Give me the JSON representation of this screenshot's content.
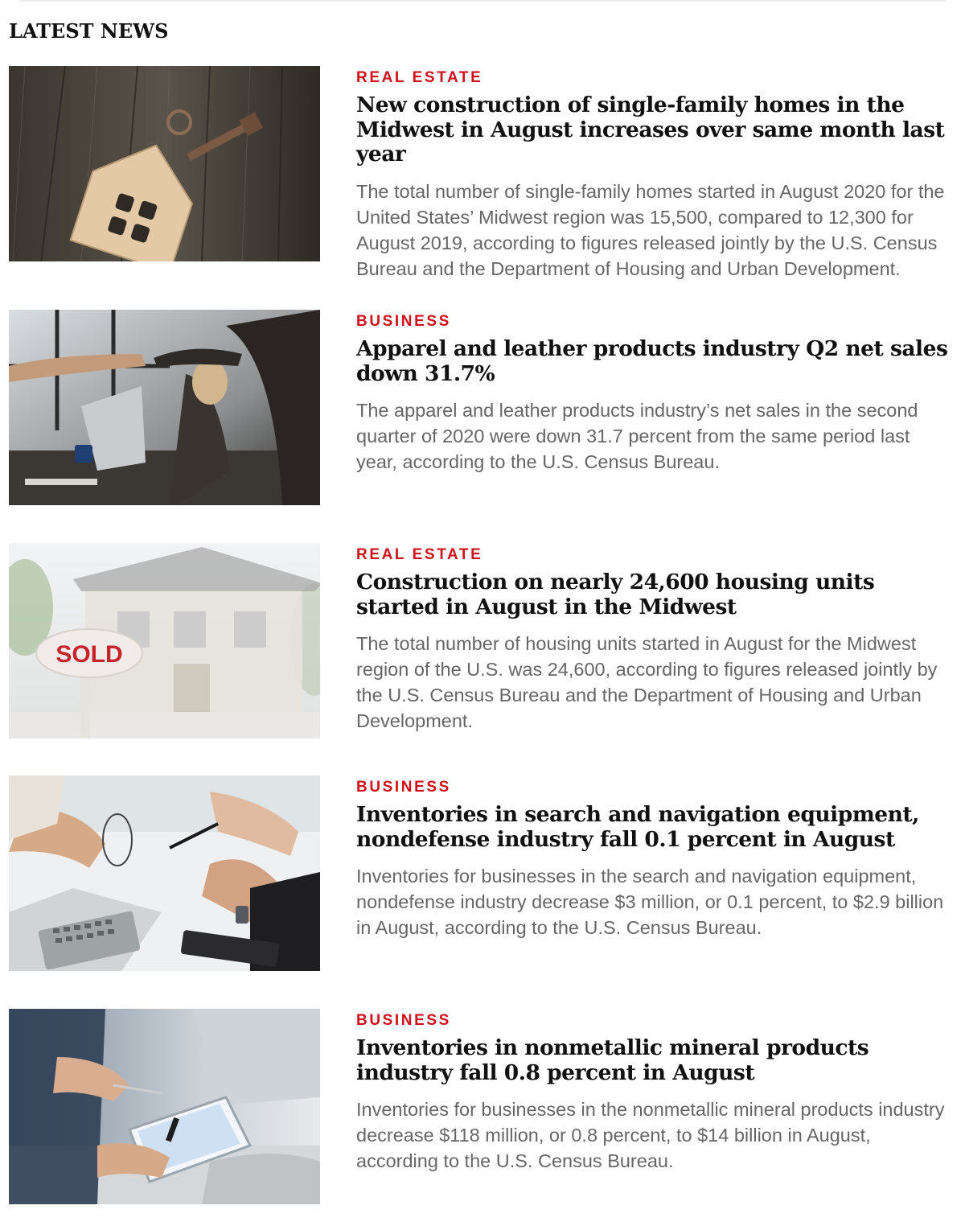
{
  "section": {
    "title": "LATEST NEWS"
  },
  "articles": [
    {
      "category": "REAL ESTATE",
      "headline": "New construction of single-family homes in the Midwest in August increases over same month last year",
      "excerpt": "The total number of single-family homes started in August 2020 for the United States’ Midwest region was 15,500, compared to 12,300 for August 2019, according to figures released jointly by the U.S. Census Bureau and the Department of Housing and Urban Development.",
      "image": "wooden-house-keychain-photo"
    },
    {
      "category": "BUSINESS",
      "headline": "Apparel and leather products industry Q2 net sales down 31.7%",
      "excerpt": "The apparel and leather products industry’s net sales in the second quarter of 2020 were down 31.7 percent from the same period last year, according to the U.S. Census Bureau.",
      "image": "business-handshake-photo"
    },
    {
      "category": "REAL ESTATE",
      "headline": "Construction on nearly 24,600 housing units started in August in the Midwest",
      "excerpt": "The total number of housing units started in August for the Midwest region of the U.S. was 24,600, according to figures released jointly by the U.S. Census Bureau and the Department of Housing and Urban Development.",
      "image": "sold-sign-house-photo",
      "image_text": "SOLD"
    },
    {
      "category": "BUSINESS",
      "headline": "Inventories in search and navigation equipment, nondefense industry fall 0.1 percent in August",
      "excerpt": "Inventories for businesses in the search and navigation equipment, nondefense industry decrease $3 million, or 0.1 percent, to $2.9 billion in August, according to the U.S. Census Bureau.",
      "image": "meeting-table-keyboard-photo"
    },
    {
      "category": "BUSINESS",
      "headline": "Inventories in nonmetallic mineral products industry fall 0.8 percent in August",
      "excerpt": "Inventories for businesses in the nonmetallic mineral products industry decrease $118 million, or 0.8 percent, to $14 billion in August, according to the U.S. Census Bureau.",
      "image": "tablet-meeting-photo"
    }
  ],
  "colors": {
    "category": "#d1101c",
    "headline": "#111111",
    "excerpt": "#666666"
  }
}
